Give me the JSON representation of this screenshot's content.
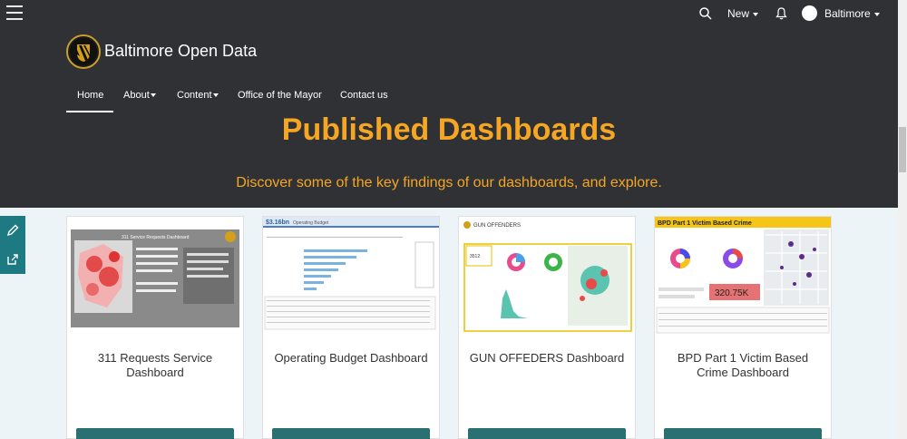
{
  "topbar": {
    "new_label": "New",
    "user_label": "Baltimore"
  },
  "site": {
    "title": "Baltimore Open Data"
  },
  "nav": {
    "items": [
      {
        "label": "Home"
      },
      {
        "label": "About"
      },
      {
        "label": "Content"
      },
      {
        "label": "Office of the Mayor"
      },
      {
        "label": "Contact us"
      }
    ]
  },
  "hero": {
    "headline": "Published Dashboards",
    "subhead": "Discover some of the key findings of our dashboards, and explore."
  },
  "cards": [
    {
      "title": "311 Requests Service Dashboard",
      "thumb_heading": "311 Service Requests Dashboard"
    },
    {
      "title": "Operating Budget Dashboard",
      "thumb_heading": "$3.16bn",
      "thumb_subheading": "Operating Budget"
    },
    {
      "title": "GUN OFFEDERS Dashboard",
      "thumb_heading": "GUN OFFENDERS",
      "thumb_count": "3512"
    },
    {
      "title": "BPD Part 1 Victim Based Crime Dashboard",
      "thumb_heading": "BPD Part 1 Victim Based Crime",
      "thumb_kpi": "320.75K"
    }
  ],
  "colors": {
    "hero_bg": "#2f3135",
    "accent": "#f5a623",
    "teal": "#1d7a82"
  }
}
